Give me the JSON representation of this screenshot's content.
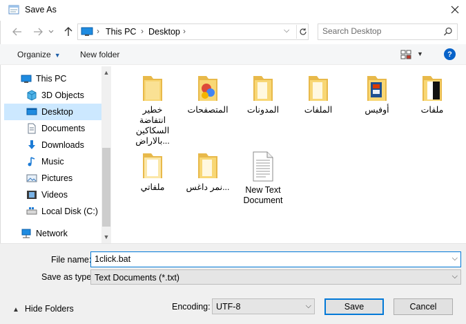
{
  "window": {
    "title": "Save As"
  },
  "address": {
    "breadcrumbs": [
      "This PC",
      "Desktop"
    ]
  },
  "search": {
    "placeholder": "Search Desktop"
  },
  "toolbar": {
    "organize_label": "Organize",
    "new_folder_label": "New folder",
    "help_label": "?"
  },
  "sidebar": {
    "items": [
      {
        "label": "This PC",
        "icon": "pc-icon"
      },
      {
        "label": "3D Objects",
        "icon": "3d-objects-icon"
      },
      {
        "label": "Desktop",
        "icon": "desktop-icon",
        "selected": true
      },
      {
        "label": "Documents",
        "icon": "documents-icon"
      },
      {
        "label": "Downloads",
        "icon": "downloads-icon"
      },
      {
        "label": "Music",
        "icon": "music-icon"
      },
      {
        "label": "Pictures",
        "icon": "pictures-icon"
      },
      {
        "label": "Videos",
        "icon": "videos-icon"
      },
      {
        "label": "Local Disk (C:)",
        "icon": "drive-icon"
      },
      {
        "label": "Network",
        "icon": "network-icon"
      }
    ]
  },
  "files": [
    {
      "name": "خطير\nانتفاضة\nالسكاكين\nبالاراض...",
      "type": "folder"
    },
    {
      "name": "المتصفحات",
      "type": "folder-browsers"
    },
    {
      "name": "المدونات",
      "type": "folder"
    },
    {
      "name": "الملفات",
      "type": "folder"
    },
    {
      "name": "أوفيس",
      "type": "folder-office"
    },
    {
      "name": "ملفات",
      "type": "folder-files"
    },
    {
      "name": "ملفاتي",
      "type": "folder-light"
    },
    {
      "name": "نمر داغس...",
      "type": "folder"
    },
    {
      "name": "New Text\nDocument",
      "type": "text-document"
    }
  ],
  "form": {
    "file_name_label": "File name:",
    "file_name_value": "1click.bat",
    "save_as_type_label": "Save as type:",
    "save_as_type_value": "Text Documents (*.txt)",
    "encoding_label": "Encoding:",
    "encoding_value": "UTF-8",
    "hide_folders_label": "Hide Folders",
    "save_label": "Save",
    "cancel_label": "Cancel"
  },
  "colors": {
    "accent": "#0078d7",
    "selection": "#cce8ff",
    "folder": "#f8d775"
  }
}
